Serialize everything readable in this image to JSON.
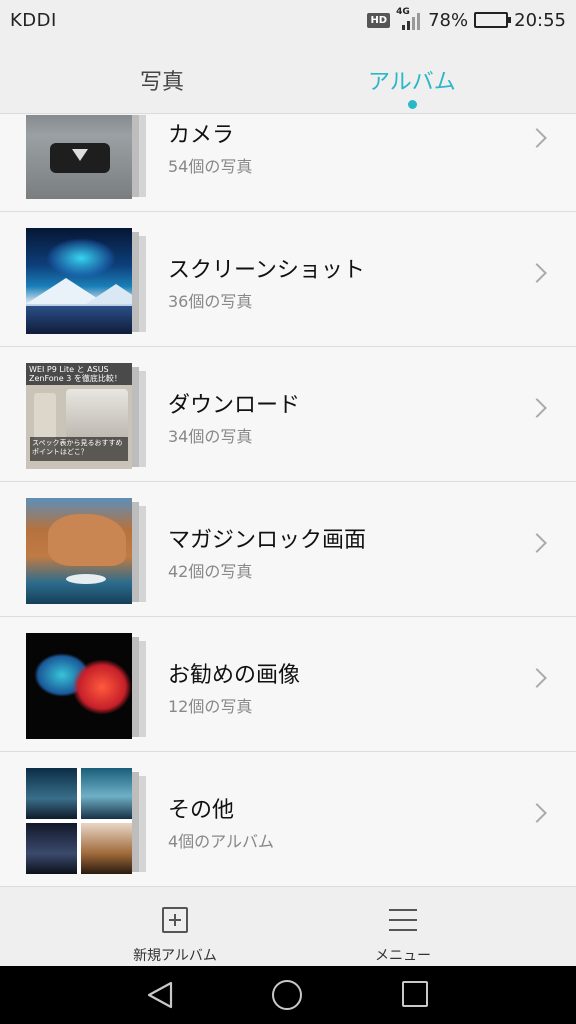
{
  "status_bar": {
    "carrier": "KDDI",
    "hd": "HD",
    "network": "4G",
    "battery_percent": "78%",
    "battery_level": 0.78,
    "time": "20:55"
  },
  "tabs": [
    {
      "label": "写真",
      "active": false
    },
    {
      "label": "アルバム",
      "active": true
    }
  ],
  "accent_color": "#2bb7c7",
  "albums": [
    {
      "title": "カメラ",
      "count": "54個の写真",
      "thumb": "camera"
    },
    {
      "title": "スクリーンショット",
      "count": "36個の写真",
      "thumb": "screens"
    },
    {
      "title": "ダウンロード",
      "count": "34個の写真",
      "thumb": "download"
    },
    {
      "title": "マガジンロック画面",
      "count": "42個の写真",
      "thumb": "magazine"
    },
    {
      "title": "お勧めの画像",
      "count": "12個の写真",
      "thumb": "recommend"
    },
    {
      "title": "その他",
      "count": "4個のアルバム",
      "thumb": "other"
    }
  ],
  "download_thumb_text": {
    "band": "WEI P9 Lite と ASUS ZenFone 3 を徹底比較！",
    "caption": "スペック表から見るおすすめポイントはどこ？"
  },
  "toolbar": {
    "new_album_label": "新規アルバム",
    "menu_label": "メニュー"
  },
  "icons": {
    "new_album": "plus-square-icon",
    "menu": "hamburger-icon",
    "back": "triangle-back-icon",
    "home": "circle-home-icon",
    "recent": "square-recent-icon",
    "chevron": "chevron-right-icon"
  }
}
